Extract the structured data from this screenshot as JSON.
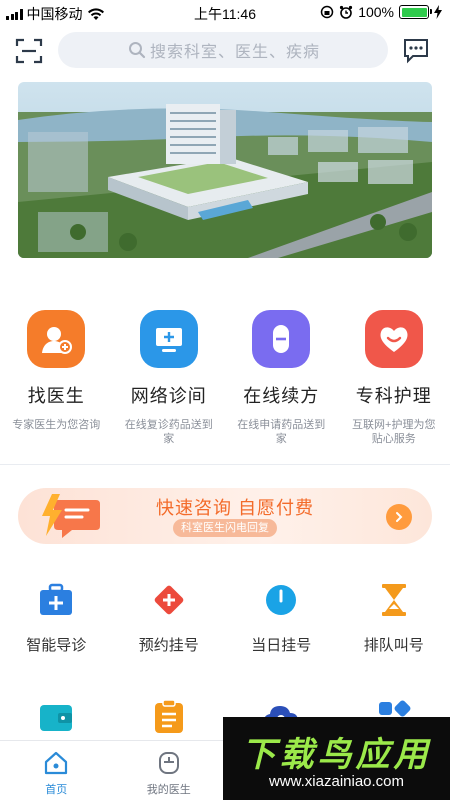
{
  "status_bar": {
    "carrier": "中国移动",
    "time": "上午11:46",
    "battery": "100%"
  },
  "header": {
    "search_placeholder": "搜索科室、医生、疾病",
    "icons": {
      "scan": "scan-icon",
      "search": "search-icon",
      "message": "message-icon"
    }
  },
  "banner": {
    "alt": "hospital-aerial-photo"
  },
  "services": [
    {
      "title": "找医生",
      "sub": "专家医生为您咨询",
      "color": "#f57c2a",
      "icon": "doctor-icon"
    },
    {
      "title": "网络诊间",
      "sub": "在线复诊药品送到家",
      "color": "#2b97e8",
      "icon": "monitor-icon"
    },
    {
      "title": "在线续方",
      "sub": "在线申请药品送到家",
      "color": "#7a6cf0",
      "icon": "capsule-icon"
    },
    {
      "title": "专科护理",
      "sub": "互联网+护理为您贴心服务",
      "color": "#f0574a",
      "icon": "heart-icon"
    }
  ],
  "promo": {
    "title": "快速咨询 自愿付费",
    "sub": "科室医生闪电回复",
    "colors": {
      "text": "#f36b2a",
      "arrow": "#ff9b3d"
    }
  },
  "grid": [
    {
      "label": "智能导诊",
      "icon": "medical-kit-icon",
      "color": "#2b7fe0"
    },
    {
      "label": "预约挂号",
      "icon": "plus-diamond-icon",
      "color": "#ec4a3c"
    },
    {
      "label": "当日挂号",
      "icon": "clock-icon",
      "color": "#1aa3e6"
    },
    {
      "label": "排队叫号",
      "icon": "hourglass-icon",
      "color": "#f49a1c"
    },
    {
      "label": "",
      "icon": "wallet-icon",
      "color": "#17b3c9"
    },
    {
      "label": "",
      "icon": "clipboard-icon",
      "color": "#f59a1a"
    },
    {
      "label": "",
      "icon": "cloud-icon",
      "color": "#2b4fb8"
    },
    {
      "label": "",
      "icon": "apps-icon",
      "color": "#2b7fe0"
    }
  ],
  "tabbar": [
    {
      "label": "首页",
      "icon": "home-icon",
      "active": true
    },
    {
      "label": "我的医生",
      "icon": "my-doctor-icon",
      "active": false
    }
  ],
  "watermark": {
    "title": "下载鸟应用",
    "url": "www.xiazainiao.com"
  }
}
